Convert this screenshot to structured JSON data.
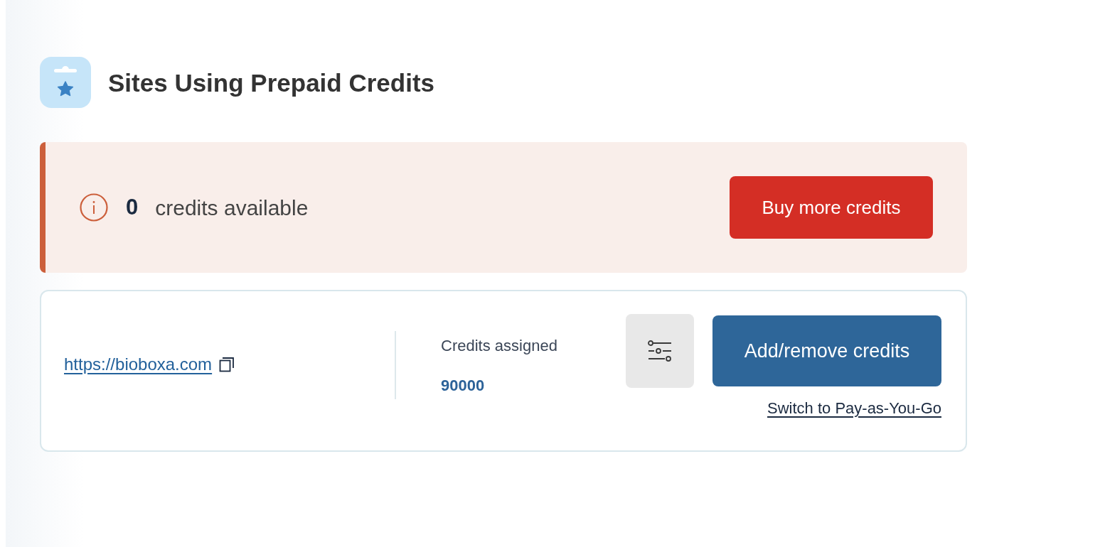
{
  "header": {
    "title": "Sites Using Prepaid Credits"
  },
  "credits_alert": {
    "count": "0",
    "label": "credits available",
    "button": "Buy more credits"
  },
  "sites": [
    {
      "url": "https://bioboxa.com",
      "credits_label": "Credits assigned",
      "credits": "90000",
      "primary_button": "Add/remove credits",
      "link": "Switch to Pay-as-You-Go"
    }
  ]
}
